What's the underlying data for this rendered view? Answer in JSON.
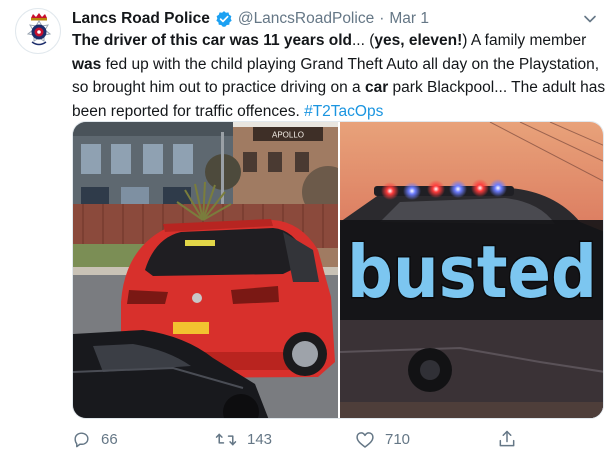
{
  "author": {
    "display_name": "Lancs Road Police",
    "handle": "@LancsRoadPolice",
    "separator": "·",
    "date": "Mar 1",
    "avatar_icon": "lancashire-police-crest",
    "verified_icon": "verified-badge-icon"
  },
  "tweet": {
    "seg_intro_bold": "The driver of this car was 11 years old",
    "seg_ellipsis_1": "... (",
    "seg_yes_bold": "yes, eleven!",
    "seg_after_yes": ") A family member ",
    "seg_was_bold": "was",
    "seg_middle": " fed up with the child playing Grand Theft Auto all day on the Playstation, so brought him out to practice driving on a ",
    "seg_car_bold": "car",
    "seg_end": " park Blackpool... The adult has been reported for traffic offences. ",
    "hashtag": "#T2TacOps"
  },
  "media": {
    "left_image_icon": "red-car-photo",
    "right_overlay_text": "busted",
    "building_sign_text": "APOLLO"
  },
  "actions": {
    "reply_count": "66",
    "retweet_count": "143",
    "like_count": "710"
  },
  "colors": {
    "link": "#1b95e0",
    "muted": "#657786",
    "text": "#14171a",
    "verified": "#1da1f2"
  }
}
